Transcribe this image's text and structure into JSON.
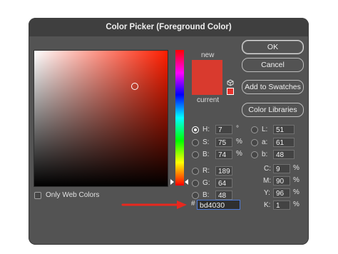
{
  "dialog": {
    "title": "Color Picker (Foreground Color)"
  },
  "preview": {
    "new_label": "new",
    "current_label": "current",
    "new_color": "#D93A2E",
    "current_color": "#D93A2E",
    "gamut_swatch_color": "#E8322C",
    "cube_icon": "cube-icon"
  },
  "buttons": {
    "ok": "OK",
    "cancel": "Cancel",
    "add_to_swatches": "Add to Swatches",
    "color_libraries": "Color Libraries"
  },
  "hsb": {
    "h_label": "H:",
    "h_value": "7",
    "h_unit": "°",
    "s_label": "S:",
    "s_value": "75",
    "s_unit": "%",
    "b_label": "B:",
    "b_value": "74",
    "b_unit": "%"
  },
  "rgb": {
    "r_label": "R:",
    "r_value": "189",
    "g_label": "G:",
    "g_value": "64",
    "b_label": "B:",
    "b_value": "48"
  },
  "lab": {
    "l_label": "L:",
    "l_value": "51",
    "a_label": "a:",
    "a_value": "61",
    "b_label": "b:",
    "b_value": "48"
  },
  "cmyk": {
    "c_label": "C:",
    "c_value": "9",
    "c_unit": "%",
    "m_label": "M:",
    "m_value": "90",
    "m_unit": "%",
    "y_label": "Y:",
    "y_value": "96",
    "y_unit": "%",
    "k_label": "K:",
    "k_value": "1",
    "k_unit": "%"
  },
  "hex": {
    "hash": "#",
    "value": "bd4030"
  },
  "options": {
    "only_web_colors": "Only Web Colors",
    "only_web_colors_checked": false
  },
  "annotation": {
    "arrow_color": "#E8281E"
  }
}
